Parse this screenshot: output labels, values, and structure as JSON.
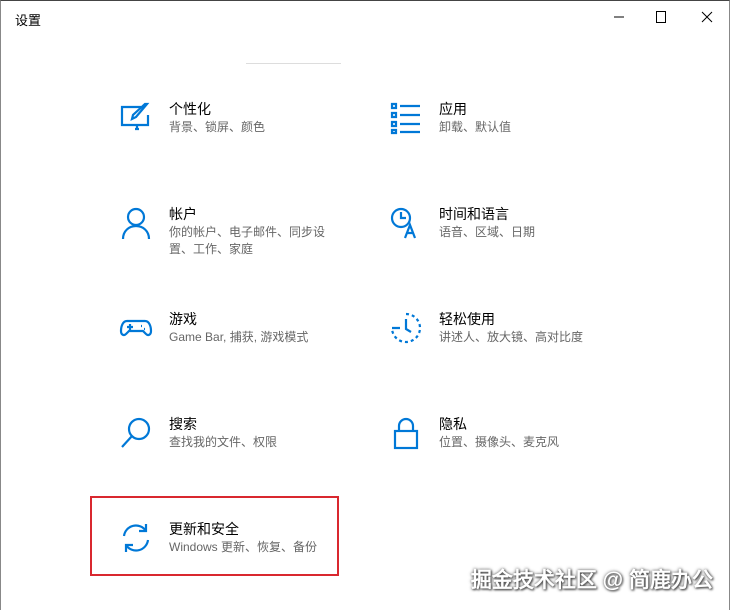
{
  "window": {
    "title": "设置",
    "minimize": "minimize",
    "maximize": "maximize",
    "close": "close"
  },
  "tiles": [
    {
      "title": "个性化",
      "subtitle": "背景、锁屏、颜色",
      "icon": "personalization-icon"
    },
    {
      "title": "应用",
      "subtitle": "卸载、默认值",
      "icon": "apps-icon"
    },
    {
      "title": "帐户",
      "subtitle": "你的帐户、电子邮件、同步设置、工作、家庭",
      "icon": "account-icon"
    },
    {
      "title": "时间和语言",
      "subtitle": "语音、区域、日期",
      "icon": "time-language-icon"
    },
    {
      "title": "游戏",
      "subtitle": "Game Bar, 捕获, 游戏模式",
      "icon": "gaming-icon"
    },
    {
      "title": "轻松使用",
      "subtitle": "讲述人、放大镜、高对比度",
      "icon": "ease-of-access-icon"
    },
    {
      "title": "搜索",
      "subtitle": "查找我的文件、权限",
      "icon": "search-icon"
    },
    {
      "title": "隐私",
      "subtitle": "位置、摄像头、麦克风",
      "icon": "lock-icon"
    },
    {
      "title": "更新和安全",
      "subtitle": "Windows 更新、恢复、备份",
      "icon": "update-icon"
    }
  ],
  "watermark": "掘金技术社区 @ 简鹿办公",
  "colors": {
    "accent": "#0078d7",
    "highlight": "#d9282f"
  }
}
